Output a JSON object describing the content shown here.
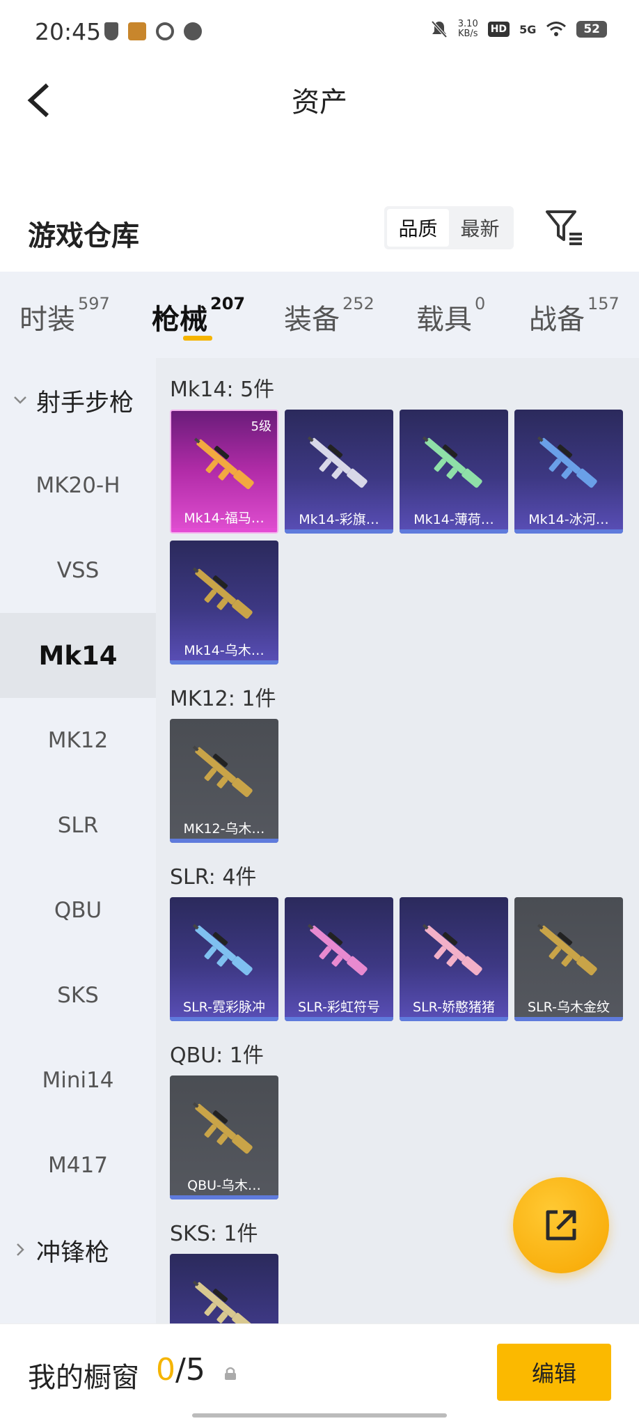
{
  "status_bar": {
    "time": "20:45",
    "net_speed_value": "3.10",
    "net_speed_unit": "KB/s",
    "hd": "HD",
    "network": "5G",
    "battery": "52"
  },
  "header": {
    "title": "资产"
  },
  "warehouse": {
    "title": "游戏仓库",
    "sort_options": [
      "品质",
      "最新"
    ],
    "active_sort": "品质"
  },
  "tabs": [
    {
      "label": "时装",
      "count": "597"
    },
    {
      "label": "枪械",
      "count": "207",
      "active": true
    },
    {
      "label": "装备",
      "count": "252"
    },
    {
      "label": "载具",
      "count": "0"
    },
    {
      "label": "战备",
      "count": "157"
    }
  ],
  "sidebar": {
    "group1": "射手步枪",
    "items": [
      "MK20-H",
      "VSS",
      "Mk14",
      "MK12",
      "SLR",
      "QBU",
      "SKS",
      "Mini14",
      "M417"
    ],
    "active_item": "Mk14",
    "group2": "冲锋枪"
  },
  "groups": [
    {
      "title": "Mk14: 5件",
      "cards": [
        {
          "label": "Mk14-福马…",
          "style": "pink",
          "level": "5级",
          "gun_color": "#f2a940"
        },
        {
          "label": "Mk14-彩旗…",
          "style": "purple",
          "gun_color": "#d8d8e8"
        },
        {
          "label": "Mk14-薄荷…",
          "style": "purple",
          "gun_color": "#8fe0a8"
        },
        {
          "label": "Mk14-冰河…",
          "style": "purple",
          "gun_color": "#6aa0e8"
        },
        {
          "label": "Mk14-乌木…",
          "style": "purple",
          "gun_color": "#c9a448"
        }
      ]
    },
    {
      "title": "MK12: 1件",
      "cards": [
        {
          "label": "MK12-乌木…",
          "style": "gray",
          "gun_color": "#c9a448"
        }
      ]
    },
    {
      "title": "SLR: 4件",
      "cards": [
        {
          "label": "SLR-霓彩脉冲",
          "style": "purple",
          "gun_color": "#7fc0f0"
        },
        {
          "label": "SLR-彩虹符号",
          "style": "purple",
          "gun_color": "#e88ad0"
        },
        {
          "label": "SLR-娇憨猪猪",
          "style": "purple",
          "gun_color": "#f2b0c8"
        },
        {
          "label": "SLR-乌木金纹",
          "style": "gray",
          "gun_color": "#c9a448"
        }
      ]
    },
    {
      "title": "QBU: 1件",
      "cards": [
        {
          "label": "QBU-乌木…",
          "style": "gray",
          "gun_color": "#c9a448"
        }
      ]
    },
    {
      "title": "SKS: 1件",
      "cards": [
        {
          "label": "",
          "style": "purple",
          "gun_color": "#d8c890"
        }
      ]
    }
  ],
  "bottom": {
    "title": "我的橱窗",
    "current": "0",
    "total": "/5",
    "edit_label": "编辑"
  },
  "colors": {
    "accent": "#f5b400",
    "tab_bg": "#eef1f7",
    "card_bar": "#5f7bdc"
  }
}
